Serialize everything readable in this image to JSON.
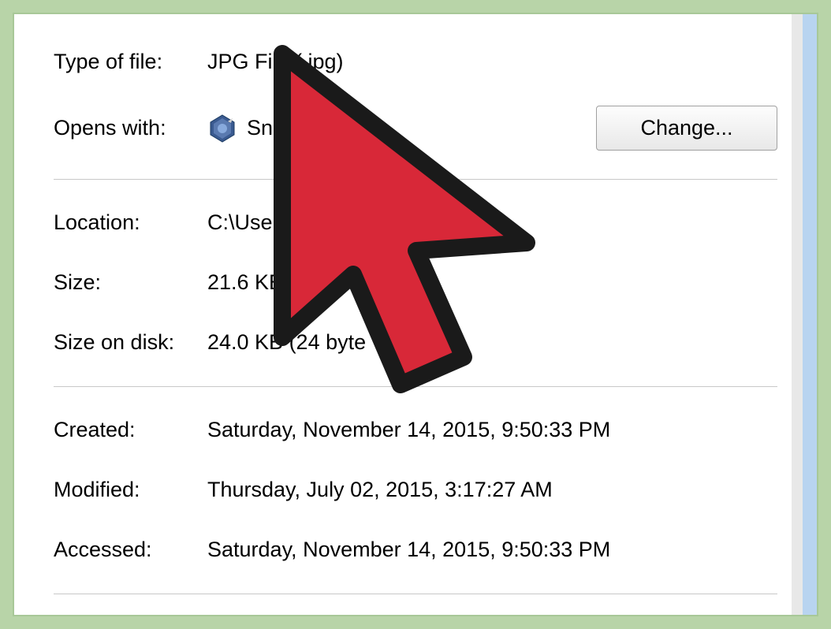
{
  "properties": {
    "type_of_file": {
      "label": "Type of file:",
      "value": "JPG File (.jpg)"
    },
    "opens_with": {
      "label": "Opens with:",
      "app_name": "Snagit",
      "change_button": "Change..."
    },
    "location": {
      "label": "Location:",
      "value": "C:\\Users\\Us"
    },
    "size": {
      "label": "Size:",
      "value": "21.6 KB (22"
    },
    "size_on_disk": {
      "label": "Size on disk:",
      "value": "24.0 KB (24     byte"
    },
    "created": {
      "label": "Created:",
      "value": "Saturday, November 14, 2015, 9:50:33 PM"
    },
    "modified": {
      "label": "Modified:",
      "value": "Thursday, July 02, 2015, 3:17:27 AM"
    },
    "accessed": {
      "label": "Accessed:",
      "value": "Saturday, November 14, 2015, 9:50:33 PM"
    }
  }
}
